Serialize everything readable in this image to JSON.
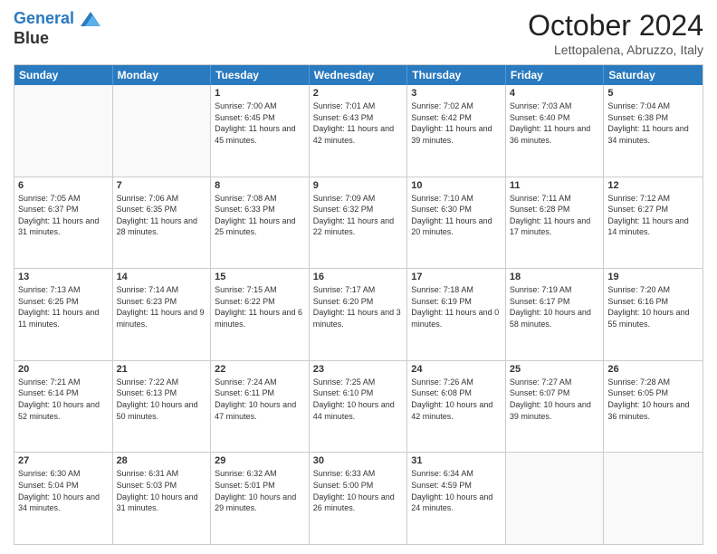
{
  "header": {
    "logo_line1": "General",
    "logo_line2": "Blue",
    "month": "October 2024",
    "location": "Lettopalena, Abruzzo, Italy"
  },
  "weekdays": [
    "Sunday",
    "Monday",
    "Tuesday",
    "Wednesday",
    "Thursday",
    "Friday",
    "Saturday"
  ],
  "rows": [
    [
      {
        "day": "",
        "empty": true
      },
      {
        "day": "",
        "empty": true
      },
      {
        "day": "1",
        "sr": "7:00 AM",
        "ss": "6:45 PM",
        "dl": "11 hours and 45 minutes."
      },
      {
        "day": "2",
        "sr": "7:01 AM",
        "ss": "6:43 PM",
        "dl": "11 hours and 42 minutes."
      },
      {
        "day": "3",
        "sr": "7:02 AM",
        "ss": "6:42 PM",
        "dl": "11 hours and 39 minutes."
      },
      {
        "day": "4",
        "sr": "7:03 AM",
        "ss": "6:40 PM",
        "dl": "11 hours and 36 minutes."
      },
      {
        "day": "5",
        "sr": "7:04 AM",
        "ss": "6:38 PM",
        "dl": "11 hours and 34 minutes."
      }
    ],
    [
      {
        "day": "6",
        "sr": "7:05 AM",
        "ss": "6:37 PM",
        "dl": "11 hours and 31 minutes."
      },
      {
        "day": "7",
        "sr": "7:06 AM",
        "ss": "6:35 PM",
        "dl": "11 hours and 28 minutes."
      },
      {
        "day": "8",
        "sr": "7:08 AM",
        "ss": "6:33 PM",
        "dl": "11 hours and 25 minutes."
      },
      {
        "day": "9",
        "sr": "7:09 AM",
        "ss": "6:32 PM",
        "dl": "11 hours and 22 minutes."
      },
      {
        "day": "10",
        "sr": "7:10 AM",
        "ss": "6:30 PM",
        "dl": "11 hours and 20 minutes."
      },
      {
        "day": "11",
        "sr": "7:11 AM",
        "ss": "6:28 PM",
        "dl": "11 hours and 17 minutes."
      },
      {
        "day": "12",
        "sr": "7:12 AM",
        "ss": "6:27 PM",
        "dl": "11 hours and 14 minutes."
      }
    ],
    [
      {
        "day": "13",
        "sr": "7:13 AM",
        "ss": "6:25 PM",
        "dl": "11 hours and 11 minutes."
      },
      {
        "day": "14",
        "sr": "7:14 AM",
        "ss": "6:23 PM",
        "dl": "11 hours and 9 minutes."
      },
      {
        "day": "15",
        "sr": "7:15 AM",
        "ss": "6:22 PM",
        "dl": "11 hours and 6 minutes."
      },
      {
        "day": "16",
        "sr": "7:17 AM",
        "ss": "6:20 PM",
        "dl": "11 hours and 3 minutes."
      },
      {
        "day": "17",
        "sr": "7:18 AM",
        "ss": "6:19 PM",
        "dl": "11 hours and 0 minutes."
      },
      {
        "day": "18",
        "sr": "7:19 AM",
        "ss": "6:17 PM",
        "dl": "10 hours and 58 minutes."
      },
      {
        "day": "19",
        "sr": "7:20 AM",
        "ss": "6:16 PM",
        "dl": "10 hours and 55 minutes."
      }
    ],
    [
      {
        "day": "20",
        "sr": "7:21 AM",
        "ss": "6:14 PM",
        "dl": "10 hours and 52 minutes."
      },
      {
        "day": "21",
        "sr": "7:22 AM",
        "ss": "6:13 PM",
        "dl": "10 hours and 50 minutes."
      },
      {
        "day": "22",
        "sr": "7:24 AM",
        "ss": "6:11 PM",
        "dl": "10 hours and 47 minutes."
      },
      {
        "day": "23",
        "sr": "7:25 AM",
        "ss": "6:10 PM",
        "dl": "10 hours and 44 minutes."
      },
      {
        "day": "24",
        "sr": "7:26 AM",
        "ss": "6:08 PM",
        "dl": "10 hours and 42 minutes."
      },
      {
        "day": "25",
        "sr": "7:27 AM",
        "ss": "6:07 PM",
        "dl": "10 hours and 39 minutes."
      },
      {
        "day": "26",
        "sr": "7:28 AM",
        "ss": "6:05 PM",
        "dl": "10 hours and 36 minutes."
      }
    ],
    [
      {
        "day": "27",
        "sr": "6:30 AM",
        "ss": "5:04 PM",
        "dl": "10 hours and 34 minutes."
      },
      {
        "day": "28",
        "sr": "6:31 AM",
        "ss": "5:03 PM",
        "dl": "10 hours and 31 minutes."
      },
      {
        "day": "29",
        "sr": "6:32 AM",
        "ss": "5:01 PM",
        "dl": "10 hours and 29 minutes."
      },
      {
        "day": "30",
        "sr": "6:33 AM",
        "ss": "5:00 PM",
        "dl": "10 hours and 26 minutes."
      },
      {
        "day": "31",
        "sr": "6:34 AM",
        "ss": "4:59 PM",
        "dl": "10 hours and 24 minutes."
      },
      {
        "day": "",
        "empty": true
      },
      {
        "day": "",
        "empty": true
      }
    ]
  ]
}
